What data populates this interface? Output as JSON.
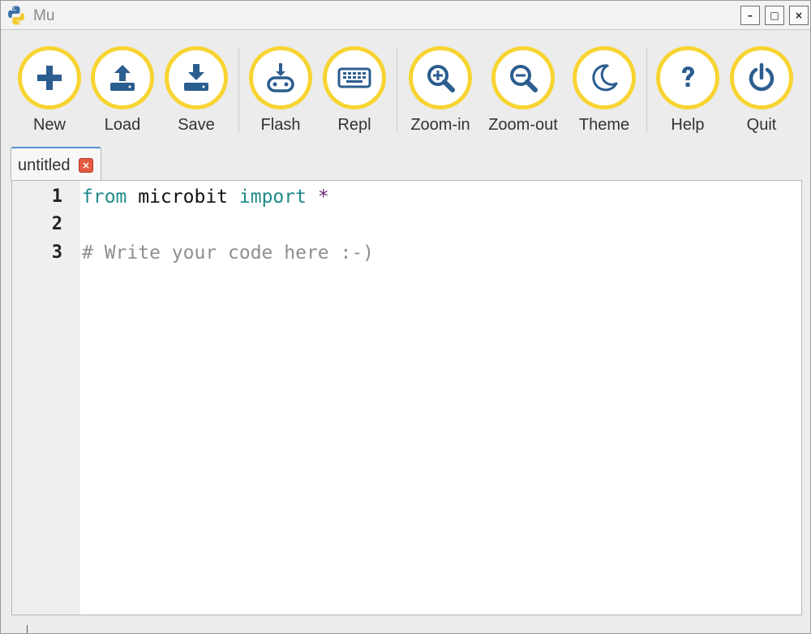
{
  "window": {
    "title": "Mu"
  },
  "titlebar_buttons": {
    "minimize": "–",
    "maximize": "□",
    "close": "×"
  },
  "toolbar": {
    "buttons": [
      {
        "label": "New",
        "icon": "plus-icon"
      },
      {
        "label": "Load",
        "icon": "upload-icon"
      },
      {
        "label": "Save",
        "icon": "download-icon"
      },
      {
        "label": "Flash",
        "icon": "microbit-flash-icon"
      },
      {
        "label": "Repl",
        "icon": "keyboard-icon"
      },
      {
        "label": "Zoom-in",
        "icon": "zoom-in-icon"
      },
      {
        "label": "Zoom-out",
        "icon": "zoom-out-icon"
      },
      {
        "label": "Theme",
        "icon": "moon-icon"
      },
      {
        "label": "Help",
        "icon": "question-icon"
      },
      {
        "label": "Quit",
        "icon": "power-icon"
      }
    ]
  },
  "tab": {
    "label": "untitled",
    "close_glyph": "×"
  },
  "editor": {
    "line_numbers": [
      "1",
      "2",
      "3"
    ],
    "lines": {
      "l1_kw1": "from",
      "l1_ident": " microbit ",
      "l1_kw2": "import",
      "l1_star": " *",
      "l3_comment": "# Write your code here :-)"
    }
  },
  "colors": {
    "accent_ring": "#f8d432",
    "icon_blue": "#2b5d8f",
    "keyword": "#1f8a8a",
    "comment": "#8f8f8f"
  }
}
